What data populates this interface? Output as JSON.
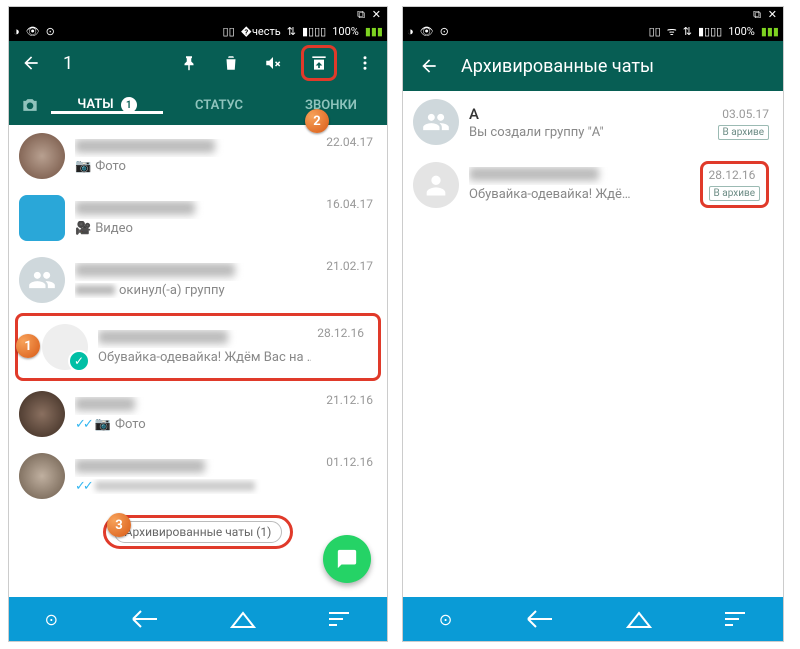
{
  "status": {
    "battery": "100%"
  },
  "left": {
    "selectedCount": "1",
    "tabs": {
      "chats": "ЧАТЫ",
      "chatsBadge": "1",
      "status": "СТАТУС",
      "calls": "ЗВОНКИ"
    },
    "rows": [
      {
        "name": "Надя Бондаренко",
        "preview": "Фото",
        "date": "22.04.17"
      },
      {
        "name": "+7 918 775-96-67",
        "preview": "Видео",
        "date": "16.04.17"
      },
      {
        "name": "День рождения Артём",
        "preview": "окинул(-а) группу",
        "date": "21.02.17"
      },
      {
        "name": "+7 906 440-68-08",
        "preview": "Обувайка-одевайка! Ждём Вас на …",
        "date": "28.12.16"
      },
      {
        "name": "Andre",
        "preview": "Фото",
        "date": "21.12.16"
      },
      {
        "name": "+7 952 847-13-20",
        "preview": "Спасибо.",
        "date": "01.12.16"
      }
    ],
    "archived": "Архивированные чаты (1)",
    "callouts": {
      "c1": "1",
      "c2": "2",
      "c3": "3"
    }
  },
  "right": {
    "title": "Архивированные чаты",
    "rows": [
      {
        "name": "A",
        "preview": "Вы создали группу \"A\"",
        "date": "03.05.17",
        "badge": "В архиве"
      },
      {
        "name": "+7 906 440-68-08",
        "preview": "Обувайка-одевайка! Ждё…",
        "date": "28.12.16",
        "badge": "В архиве"
      }
    ]
  }
}
